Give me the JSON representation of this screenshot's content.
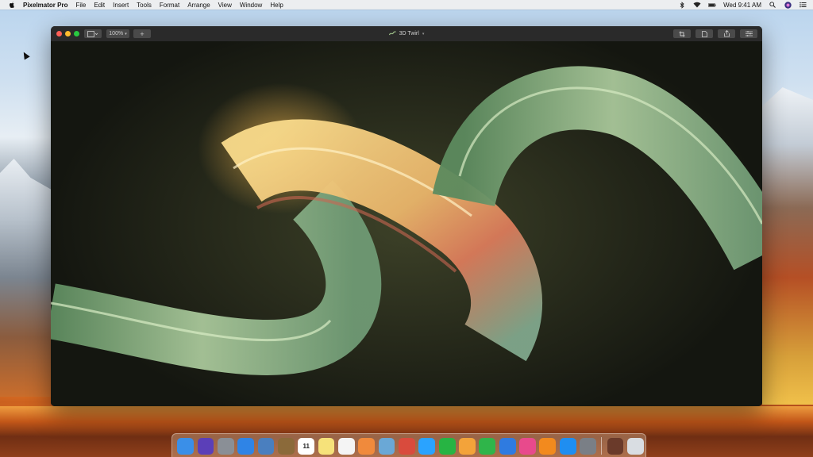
{
  "menubar": {
    "app_name": "Pixelmator Pro",
    "menus": [
      "File",
      "Edit",
      "Insert",
      "Tools",
      "Format",
      "Arrange",
      "View",
      "Window",
      "Help"
    ],
    "clock": "Wed 9:41 AM"
  },
  "window": {
    "document_title": "3D Twirl",
    "zoom": "100%",
    "add_label": "+"
  },
  "dock": {
    "apps": [
      {
        "name": "Finder",
        "icon": "finder-icon",
        "color": "#3a8fe8"
      },
      {
        "name": "Siri",
        "icon": "siri-icon",
        "color": "#5b3fb8"
      },
      {
        "name": "Launchpad",
        "icon": "launchpad-icon",
        "color": "#8a8f96"
      },
      {
        "name": "Safari",
        "icon": "safari-icon",
        "color": "#2f84e6"
      },
      {
        "name": "Preview",
        "icon": "preview-icon",
        "color": "#4a7fbf"
      },
      {
        "name": "Notefile",
        "icon": "notebook-icon",
        "color": "#8b6a3a"
      },
      {
        "name": "Calendar",
        "icon": "calendar-icon",
        "color": "#ffffff",
        "text": "11"
      },
      {
        "name": "Notes",
        "icon": "notes-icon",
        "color": "#f6e27a"
      },
      {
        "name": "Reminders",
        "icon": "reminders-icon",
        "color": "#f4f4f4"
      },
      {
        "name": "Photos",
        "icon": "photos-icon",
        "color": "#f08a3c"
      },
      {
        "name": "Image Capture",
        "icon": "image-capture-icon",
        "color": "#6aa8d6"
      },
      {
        "name": "Pixelmator Pro",
        "icon": "pixelmator-icon",
        "color": "#d94b3d"
      },
      {
        "name": "Messages",
        "icon": "messages-icon",
        "color": "#2aa3ff"
      },
      {
        "name": "FaceTime",
        "icon": "facetime-icon",
        "color": "#27b443"
      },
      {
        "name": "Pages",
        "icon": "pages-icon",
        "color": "#f3a33a"
      },
      {
        "name": "Numbers",
        "icon": "numbers-icon",
        "color": "#2fb54a"
      },
      {
        "name": "Keynote",
        "icon": "keynote-icon",
        "color": "#2f7be0"
      },
      {
        "name": "iTunes",
        "icon": "itunes-icon",
        "color": "#e84a8c"
      },
      {
        "name": "iBooks",
        "icon": "ibooks-icon",
        "color": "#f28a1e"
      },
      {
        "name": "App Store",
        "icon": "app-store-icon",
        "color": "#1f8ef1"
      },
      {
        "name": "System Preferences",
        "icon": "system-preferences-icon",
        "color": "#7a7f86"
      }
    ],
    "extra": [
      {
        "name": "Photo Stack",
        "icon": "photo-stack-icon",
        "color": "#6a3a2a"
      },
      {
        "name": "Trash",
        "icon": "trash-icon",
        "color": "#d9dde2"
      }
    ]
  }
}
